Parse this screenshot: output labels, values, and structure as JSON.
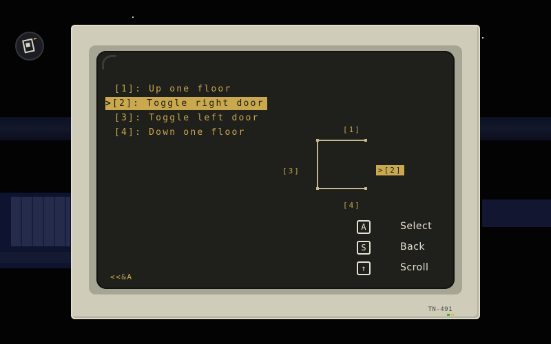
{
  "menu": {
    "items": [
      {
        "key": "[1]",
        "label": "Up one floor",
        "selected": false
      },
      {
        "key": "[2]",
        "label": "Toggle right door",
        "selected": true
      },
      {
        "key": "[3]",
        "label": "Toggle left door",
        "selected": false
      },
      {
        "key": "[4]",
        "label": "Down one floor",
        "selected": false
      }
    ],
    "cursor": ">"
  },
  "diagram": {
    "top": "[1]",
    "right": ">[2]",
    "left": "[3]",
    "bottom": "[4]"
  },
  "controls": [
    {
      "key": "A",
      "label": "Select"
    },
    {
      "key": "S",
      "label": "Back"
    },
    {
      "key": "↑",
      "label": "Scroll"
    }
  ],
  "footer_code": "<<&A",
  "model": "TN-491",
  "colors": {
    "amber": "#c9a84e",
    "screen": "#1f1f1c",
    "casing": "#cfcdb9"
  }
}
